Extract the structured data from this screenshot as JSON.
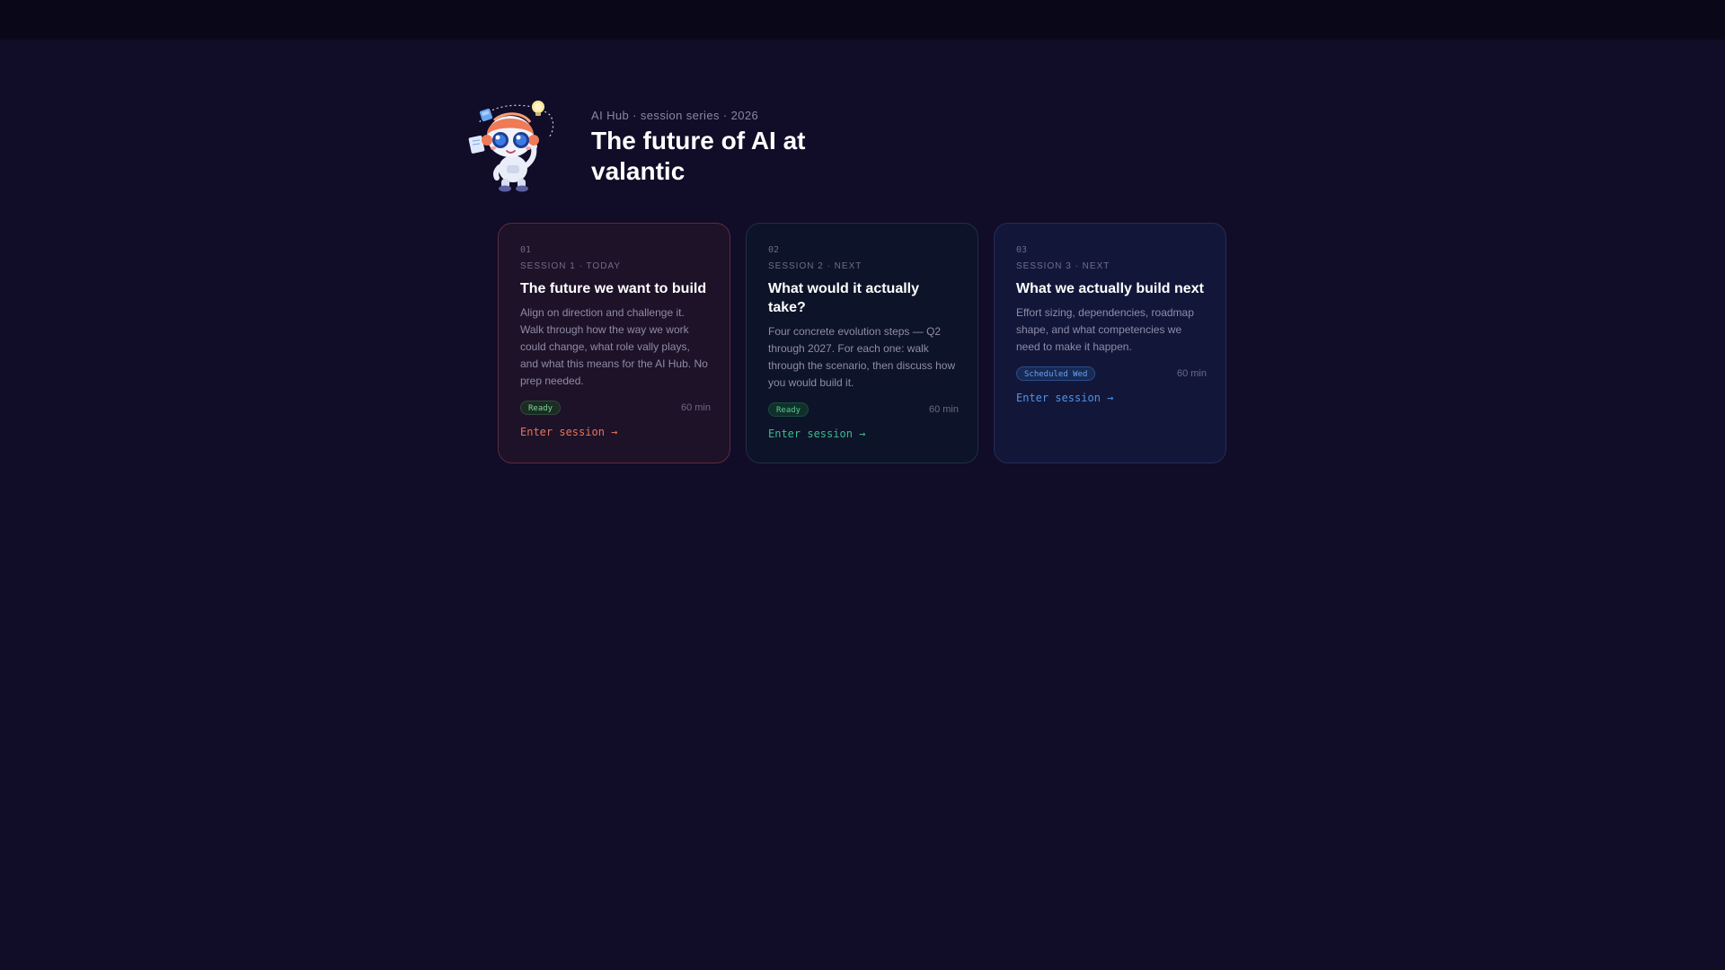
{
  "header": {
    "eyebrow": "AI Hub · session series · 2026",
    "title": "The future of AI at valantic"
  },
  "sessions": [
    {
      "number": "01",
      "kicker": "SESSION 1 · TODAY",
      "title": "The future we want to build",
      "description": "Align on direction and challenge it. Walk through how the way we work could change, what role vally plays, and what this means for the AI Hub. No prep needed.",
      "status": "Ready",
      "duration": "60 min",
      "action": "Enter session →",
      "accent": "#e8745a"
    },
    {
      "number": "02",
      "kicker": "SESSION 2 · NEXT",
      "title": "What would it actually take?",
      "description": "Four concrete evolution steps — Q2 through 2027. For each one: walk through the scenario, then discuss how you would build it.",
      "status": "Ready",
      "duration": "60 min",
      "action": "Enter session →",
      "accent": "#3dbb8e"
    },
    {
      "number": "03",
      "kicker": "SESSION 3 · NEXT",
      "title": "What we actually build next",
      "description": "Effort sizing, dependencies, roadmap shape, and what competencies we need to make it happen.",
      "status": "Scheduled Wed",
      "duration": "60 min",
      "action": "Enter session →",
      "accent": "#4d93e8"
    }
  ],
  "mascot": {
    "icon": "robot-mascot-icon"
  }
}
